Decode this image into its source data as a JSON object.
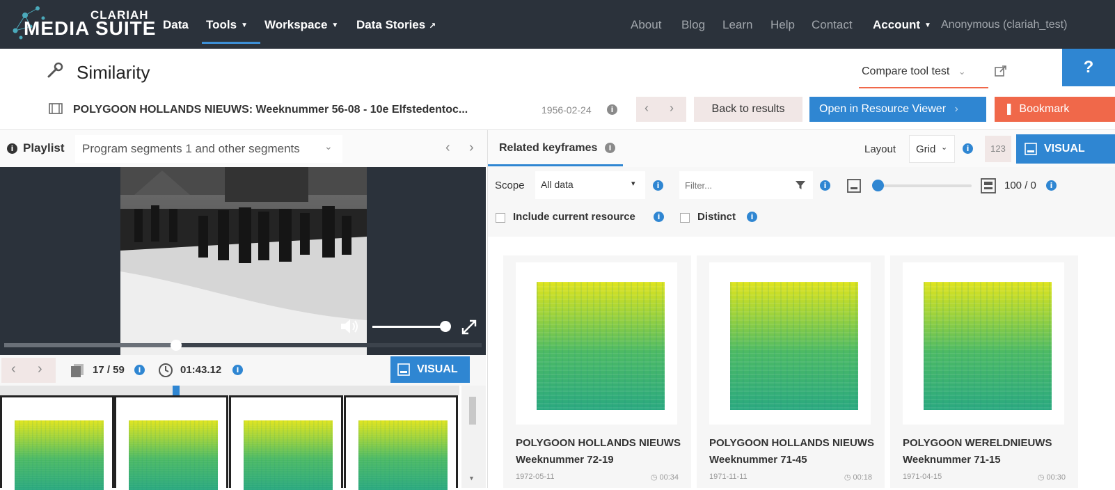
{
  "nav": {
    "brand_top": "CLARIAH",
    "brand_main": "MEDIA SUITE",
    "links_left": [
      "Data",
      "Tools",
      "Workspace",
      "Data Stories"
    ],
    "links_right": [
      "About",
      "Blog",
      "Learn",
      "Help",
      "Contact"
    ],
    "account": "Account",
    "user": "Anonymous (clariah_test)"
  },
  "page": {
    "title": "Similarity",
    "project": "Compare tool test",
    "help": "?"
  },
  "resource": {
    "title": "POLYGOON HOLLANDS NIEUWS: Weeknummer 56-08 - 10e Elfstedentoc...",
    "date": "1956-02-24",
    "back": "Back to results",
    "open": "Open in Resource Viewer",
    "bookmark": "Bookmark"
  },
  "playlist": {
    "label": "Playlist",
    "selected": "Program segments 1 and other segments"
  },
  "player": {
    "segment": "17 / 59",
    "time": "01:43.12",
    "visual": "VISUAL",
    "progress": 0.36,
    "volume": 1.0
  },
  "related": {
    "tab": "Related keyframes",
    "layout_label": "Layout",
    "layout_value": "Grid",
    "btn_123": "123",
    "visual": "VISUAL",
    "scope_label": "Scope",
    "scope_value": "All data",
    "filter_placeholder": "Filter...",
    "range_value": "100 / 0",
    "include_current": "Include current resource",
    "distinct": "Distinct"
  },
  "results": [
    {
      "title": "POLYGOON HOLLANDS NIEUWS Weeknummer 72-19",
      "date": "1972-05-11",
      "duration": "00:34"
    },
    {
      "title": "POLYGOON HOLLANDS NIEUWS Weeknummer 71-45",
      "date": "1971-11-11",
      "duration": "00:18"
    },
    {
      "title": "POLYGOON WERELDNIEUWS Weeknummer 71-15",
      "date": "1971-04-15",
      "duration": "00:30"
    }
  ],
  "colors": {
    "navbar": "#2b323b",
    "accent_blue": "#2f86d2",
    "bookmark_red": "#f0684a",
    "spectrogram_top": "#d8e219",
    "spectrogram_bottom": "#27a37e"
  }
}
